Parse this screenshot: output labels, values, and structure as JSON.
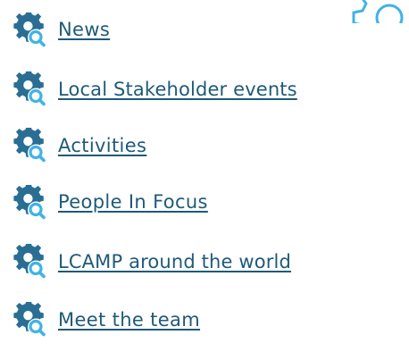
{
  "menu": {
    "items": [
      {
        "label": "News",
        "icon": "gear-search-icon"
      },
      {
        "label": "Local Stakeholder events",
        "icon": "gear-search-icon"
      },
      {
        "label": "Activities",
        "icon": "gear-search-icon"
      },
      {
        "label": "People In Focus",
        "icon": "gear-search-icon"
      },
      {
        "label": "LCAMP around the world",
        "icon": "gear-search-icon"
      },
      {
        "label": "Meet the team",
        "icon": "gear-search-icon"
      }
    ]
  },
  "colors": {
    "link": "#1f5a78",
    "icon_gear": "#2a6e94",
    "icon_magnifier": "#3fb3e6",
    "deco_outline": "#3fb3e6"
  }
}
